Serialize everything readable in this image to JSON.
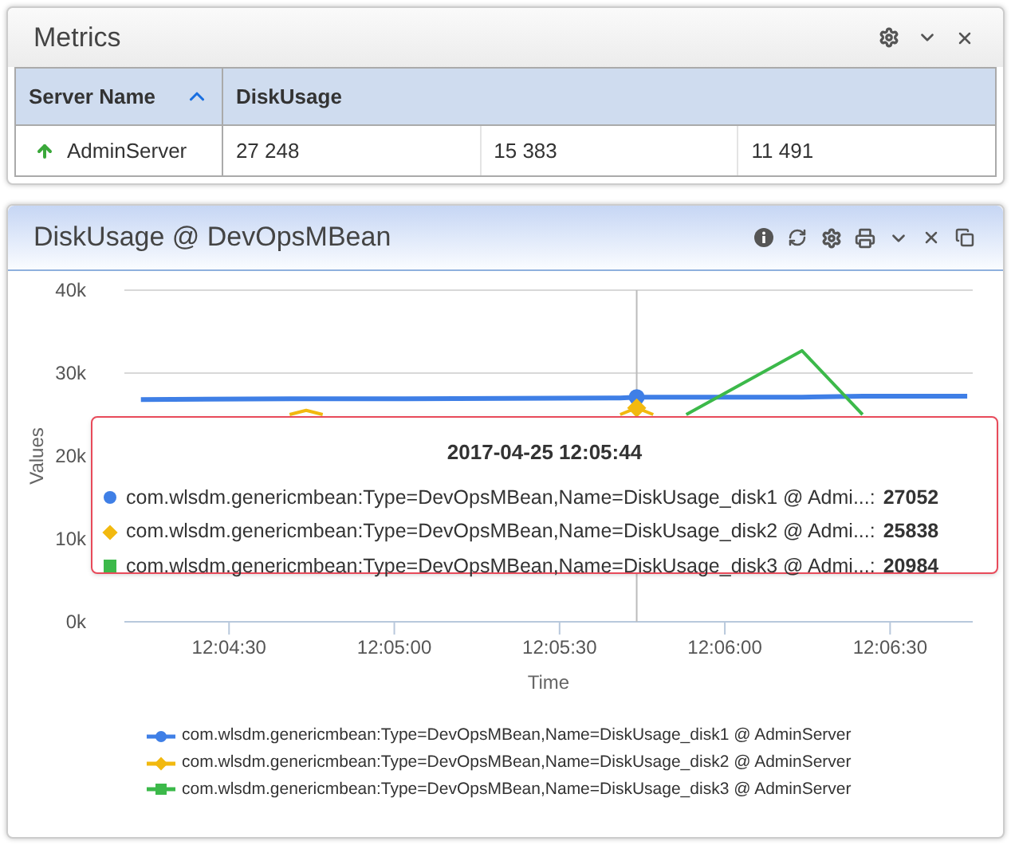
{
  "metrics": {
    "title": "Metrics",
    "columns": [
      {
        "label": "Server Name",
        "sorted": true
      },
      {
        "label": "DiskUsage",
        "sorted": false
      }
    ],
    "rows": [
      {
        "server": "AdminServer",
        "online": true,
        "values": [
          "27 248",
          "15 383",
          "11 491"
        ]
      }
    ]
  },
  "chart_panel": {
    "title": "DiskUsage @ DevOpsMBean",
    "chart_data": {
      "type": "line",
      "xlabel": "Time",
      "ylabel": "Values",
      "x": [
        43454,
        43481,
        43484,
        43487,
        43500,
        43541,
        43544,
        43547,
        43553,
        43574,
        43585,
        43604
      ],
      "series": [
        {
          "name": "com.wlsdm.genericmbean:Type=DevOpsMBean,Name=DiskUsage_disk1 @ AdminServer",
          "color": "#3f7fe6",
          "values": [
            26800,
            26900,
            26900,
            26900,
            26900,
            27000,
            27100,
            27100,
            27100,
            27100,
            27200,
            27200
          ]
        },
        {
          "name": "com.wlsdm.genericmbean:Type=DevOpsMBean,Name=DiskUsage_disk2 @ AdminServer",
          "color": "#f2b90f",
          "values": [
            null,
            25000,
            25500,
            25000,
            null,
            25000,
            25800,
            25000,
            null,
            null,
            null,
            null
          ]
        },
        {
          "name": "com.wlsdm.genericmbean:Type=DevOpsMBean,Name=DiskUsage_disk3 @ AdminServer",
          "color": "#3cb94a",
          "values": [
            null,
            null,
            null,
            null,
            null,
            null,
            null,
            null,
            25000,
            32700,
            25000,
            null
          ]
        }
      ],
      "xlim": [
        43451,
        43605
      ],
      "ylim": [
        0,
        40000
      ],
      "xticks": [
        {
          "value": 43470,
          "label": "12:04:30"
        },
        {
          "value": 43500,
          "label": "12:05:00"
        },
        {
          "value": 43530,
          "label": "12:05:30"
        },
        {
          "value": 43560,
          "label": "12:06:00"
        },
        {
          "value": 43590,
          "label": "12:06:30"
        }
      ],
      "yticks": [
        {
          "value": 0,
          "label": "0k"
        },
        {
          "value": 10000,
          "label": "10k"
        },
        {
          "value": 20000,
          "label": "20k"
        },
        {
          "value": 30000,
          "label": "30k"
        },
        {
          "value": 40000,
          "label": "40k"
        }
      ],
      "ref_lines": [
        {
          "axis": "x",
          "value": 43544
        }
      ]
    },
    "tooltip": {
      "title": "2017-04-25 12:05:44",
      "items": [
        {
          "label": "com.wlsdm.genericmbean:Type=DevOpsMBean,Name=DiskUsage_disk1 @ Admi...:",
          "value": "27052",
          "color": "#3f7fe6",
          "kind": "circle"
        },
        {
          "label": "com.wlsdm.genericmbean:Type=DevOpsMBean,Name=DiskUsage_disk2 @ Admi...:",
          "value": "25838",
          "color": "#f2b90f",
          "kind": "diamond"
        },
        {
          "label": "com.wlsdm.genericmbean:Type=DevOpsMBean,Name=DiskUsage_disk3 @ Admi...:",
          "value": "20984",
          "color": "#3cb94a",
          "kind": "square"
        }
      ]
    }
  }
}
